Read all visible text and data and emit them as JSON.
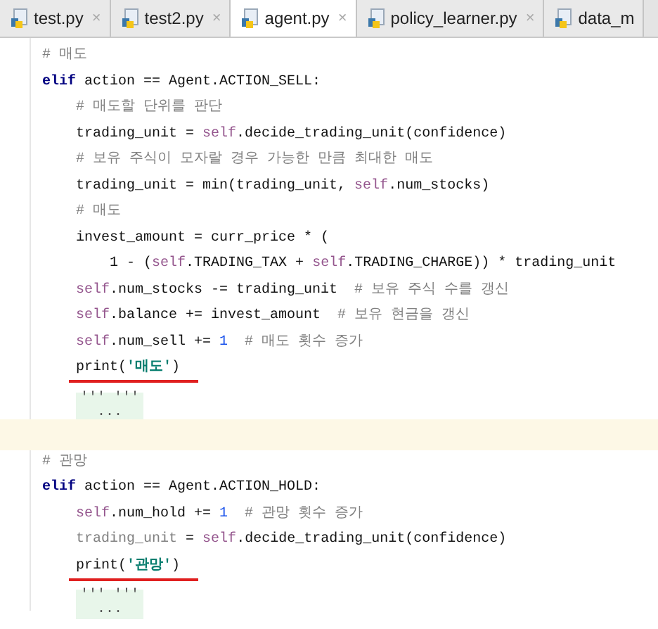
{
  "tabs": [
    {
      "label": "test.py",
      "selected": false,
      "close": "×"
    },
    {
      "label": "test2.py",
      "selected": false,
      "close": "×"
    },
    {
      "label": "agent.py",
      "selected": true,
      "close": "×"
    },
    {
      "label": "policy_learner.py",
      "selected": false,
      "close": "×"
    },
    {
      "label": "data_m",
      "selected": false
    }
  ],
  "lines": [
    {
      "kind": "code",
      "current": false,
      "segments": [
        {
          "text": "    # 매도",
          "kind": "comment"
        }
      ]
    },
    {
      "kind": "code",
      "current": false,
      "segments": [
        {
          "text": "    elif",
          "kind": "keyword"
        },
        {
          "text": " action == Agent.ACTION_SELL:",
          "kind": "plain"
        }
      ]
    },
    {
      "kind": "code",
      "current": false,
      "segments": [
        {
          "text": "        # 매도할 단위를 판단",
          "kind": "comment"
        }
      ]
    },
    {
      "kind": "code",
      "current": false,
      "segments": [
        {
          "text": "        trading_unit = ",
          "kind": "plain"
        },
        {
          "text": "self",
          "kind": "self"
        },
        {
          "text": ".decide_trading_unit(confidence)",
          "kind": "plain"
        }
      ]
    },
    {
      "kind": "code",
      "current": false,
      "segments": [
        {
          "text": "        # 보유 주식이 모자랄 경우 가능한 만큼 최대한 매도",
          "kind": "comment"
        }
      ]
    },
    {
      "kind": "code",
      "current": false,
      "segments": [
        {
          "text": "        trading_unit = min(trading_unit, ",
          "kind": "plain"
        },
        {
          "text": "self",
          "kind": "self"
        },
        {
          "text": ".num_stocks)",
          "kind": "plain"
        }
      ]
    },
    {
      "kind": "code",
      "current": false,
      "segments": [
        {
          "text": "        # 매도",
          "kind": "comment"
        }
      ]
    },
    {
      "kind": "code",
      "current": false,
      "segments": [
        {
          "text": "        invest_amount = curr_price * (",
          "kind": "plain"
        }
      ]
    },
    {
      "kind": "code",
      "current": false,
      "segments": [
        {
          "text": "            1 - (",
          "kind": "plain"
        },
        {
          "text": "self",
          "kind": "self"
        },
        {
          "text": ".TRADING_TAX + ",
          "kind": "plain"
        },
        {
          "text": "self",
          "kind": "self"
        },
        {
          "text": ".TRADING_CHARGE)) * trading_unit",
          "kind": "plain"
        }
      ]
    },
    {
      "kind": "code",
      "current": false,
      "segments": [
        {
          "text": "        self",
          "kind": "self"
        },
        {
          "text": ".num_stocks -= trading_unit",
          "kind": "plain"
        },
        {
          "text": "  # 보유 주식 수를 갱신",
          "kind": "comment"
        }
      ]
    },
    {
      "kind": "code",
      "current": false,
      "segments": [
        {
          "text": "        self",
          "kind": "self"
        },
        {
          "text": ".balance += invest_amount",
          "kind": "plain"
        },
        {
          "text": "  # 보유 현금을 갱신",
          "kind": "comment"
        }
      ]
    },
    {
      "kind": "code",
      "current": false,
      "segments": [
        {
          "text": "        self",
          "kind": "self"
        },
        {
          "text": ".num_sell += ",
          "kind": "plain"
        },
        {
          "text": "1",
          "kind": "number"
        },
        {
          "text": "  # 매도 횟수 증가",
          "kind": "comment"
        }
      ]
    },
    {
      "kind": "code",
      "current": false,
      "underlined": true,
      "segments": [
        {
          "text": "        print(",
          "kind": "plain"
        },
        {
          "text": "'매도'",
          "kind": "string"
        },
        {
          "text": ")",
          "kind": "plain"
        }
      ]
    },
    {
      "kind": "fold",
      "current": false,
      "segments": [
        {
          "text": "''' '''",
          "kind": "fold"
        },
        {
          "text": "...",
          "kind": "fold"
        }
      ]
    },
    {
      "kind": "code",
      "current": true
    },
    {
      "kind": "code",
      "current": false,
      "segments": [
        {
          "text": "    # 관망",
          "kind": "comment"
        }
      ]
    },
    {
      "kind": "code",
      "current": false,
      "segments": [
        {
          "text": "    elif",
          "kind": "keyword"
        },
        {
          "text": " action == Agent.ACTION_HOLD:",
          "kind": "plain"
        }
      ]
    },
    {
      "kind": "code",
      "current": false,
      "segments": [
        {
          "text": "        self",
          "kind": "self"
        },
        {
          "text": ".num_hold += ",
          "kind": "plain"
        },
        {
          "text": "1",
          "kind": "number"
        },
        {
          "text": "  # 관망 횟수 증가",
          "kind": "comment"
        }
      ]
    },
    {
      "kind": "code",
      "current": false,
      "segments": [
        {
          "text": "        trading_unit",
          "kind": "unused"
        },
        {
          "text": " = ",
          "kind": "plain"
        },
        {
          "text": "self",
          "kind": "self"
        },
        {
          "text": ".decide_trading_unit(confidence)",
          "kind": "plain"
        }
      ]
    },
    {
      "kind": "code",
      "current": false,
      "underlined": true,
      "segments": [
        {
          "text": "        print(",
          "kind": "plain"
        },
        {
          "text": "'관망'",
          "kind": "string"
        },
        {
          "text": ")",
          "kind": "plain"
        }
      ]
    },
    {
      "kind": "fold",
      "current": false,
      "segments": [
        {
          "text": "''' '''",
          "kind": "fold"
        },
        {
          "text": "...",
          "kind": "fold"
        }
      ]
    }
  ]
}
